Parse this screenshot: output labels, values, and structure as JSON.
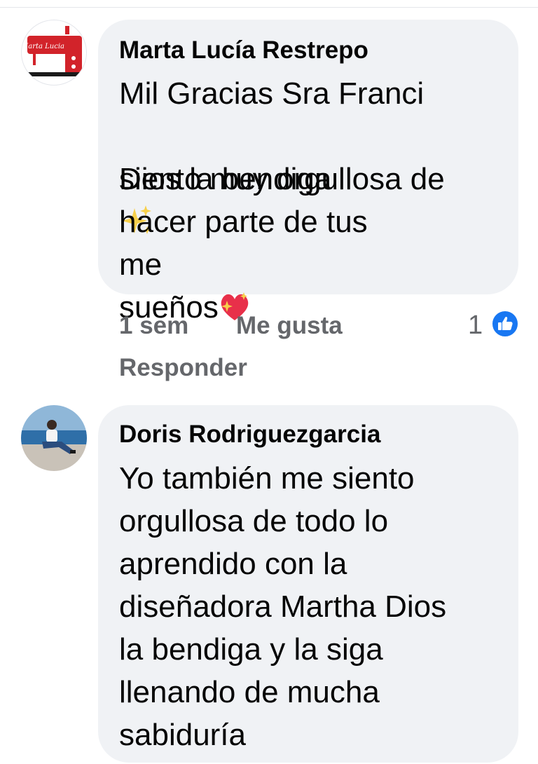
{
  "comments": [
    {
      "author": "Marta Lucía Restrepo",
      "avatar_logo_text": "Marta Lucia",
      "lines": [
        "Mil Gracias Sra Franci",
        "Dios la bendiga",
        "me",
        "siento muy orgullosa de",
        "hacer parte de tus",
        "sueños"
      ],
      "time": "1 sem",
      "like_label": "Me gusta",
      "reply_label": "Responder",
      "reaction_count": "1",
      "reaction_icon": "thumbs-up-icon",
      "emojis": [
        "sparkles-icon",
        "sparkling-heart-icon"
      ]
    },
    {
      "author": "Doris Rodriguezgarcia",
      "lines": [
        "Yo también me siento",
        "orgullosa de todo lo",
        "aprendido con la",
        "diseñadora Martha Dios",
        "la bendiga y la siga",
        "llenando de mucha",
        "sabiduría"
      ]
    }
  ],
  "colors": {
    "bubble": "#f0f2f5",
    "meta_text": "#65676b",
    "like_blue": "#1877f2",
    "logo_red": "#d2232a"
  }
}
